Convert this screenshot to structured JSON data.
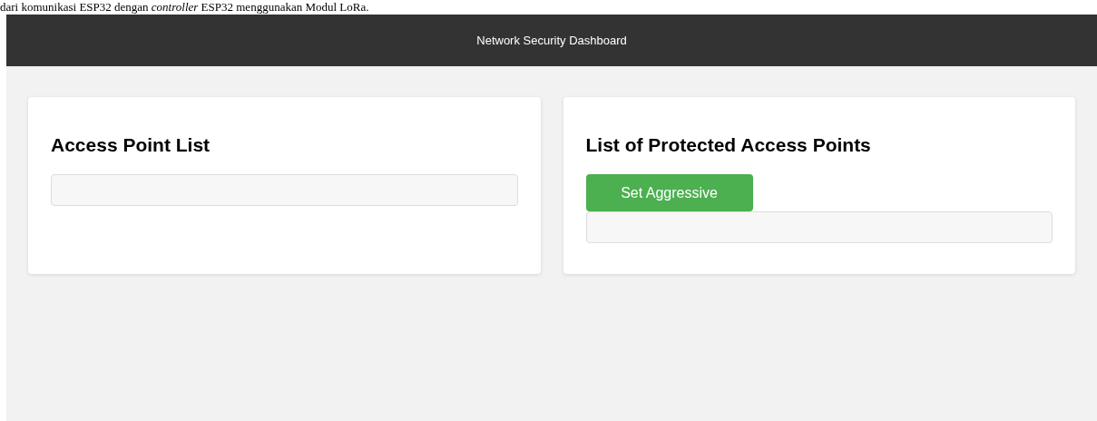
{
  "document_text": "dari komunikasi ESP32 dengan *controller* ESP32 menggunakan Modul LoRa.",
  "header": {
    "title": "Network Security Dashboard"
  },
  "cards": [
    {
      "title": "Access Point List"
    },
    {
      "title": "List of Protected Access Points",
      "buttons": [
        "Set Aggressive"
      ]
    }
  ]
}
